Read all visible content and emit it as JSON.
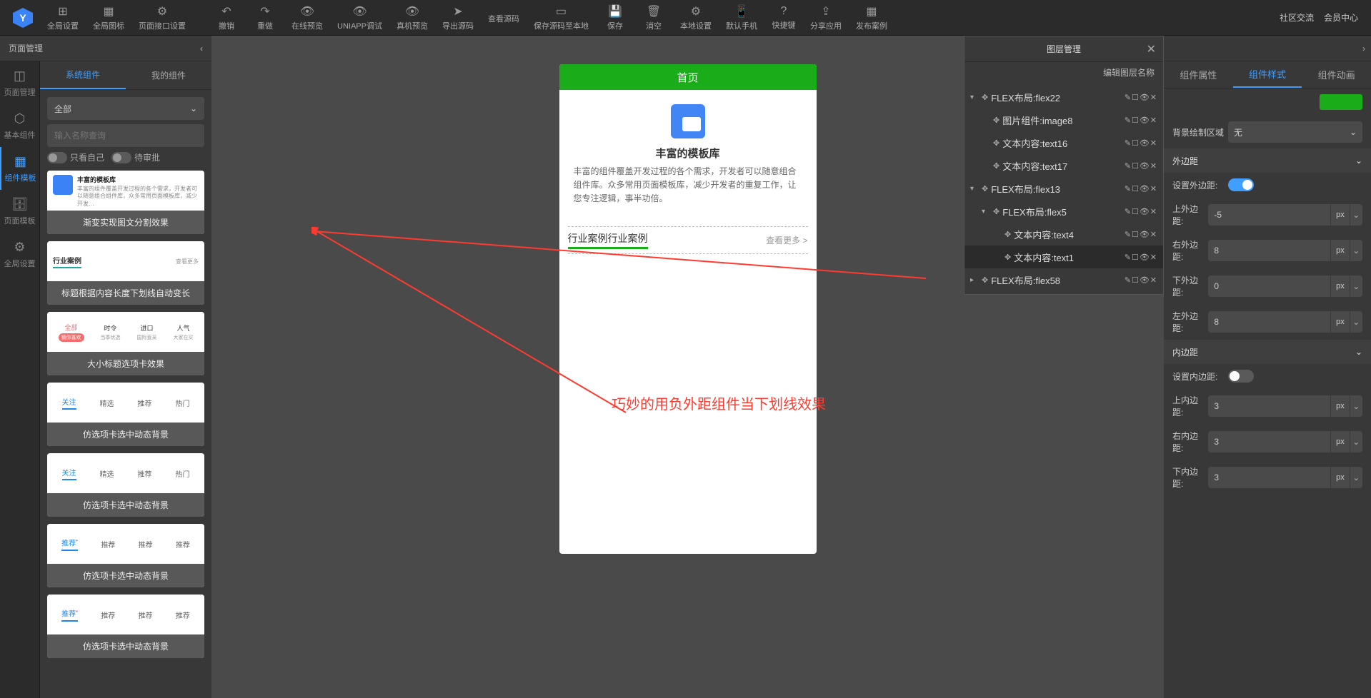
{
  "toolbar": {
    "items": [
      {
        "label": "全局设置",
        "icon": "⊞"
      },
      {
        "label": "全局图标",
        "icon": "▦"
      },
      {
        "label": "页面接口设置",
        "icon": "⚙"
      },
      {
        "label": "撤销",
        "icon": "↶"
      },
      {
        "label": "重做",
        "icon": "↷"
      },
      {
        "label": "在线预览",
        "icon": "👁"
      },
      {
        "label": "UNIAPP调试",
        "icon": "👁"
      },
      {
        "label": "真机预览",
        "icon": "👁"
      },
      {
        "label": "导出源码",
        "icon": "➤"
      },
      {
        "label": "查看源码",
        "icon": "</>"
      },
      {
        "label": "保存源码至本地",
        "icon": "▭"
      },
      {
        "label": "保存",
        "icon": "💾"
      },
      {
        "label": "消空",
        "icon": "🗑"
      },
      {
        "label": "本地设置",
        "icon": "⚙"
      },
      {
        "label": "默认手机",
        "icon": "📱"
      },
      {
        "label": "快捷键",
        "icon": "?"
      },
      {
        "label": "分享应用",
        "icon": "⇪"
      },
      {
        "label": "发布案例",
        "icon": "▦"
      }
    ],
    "right_links": [
      "社区交流",
      "会员中心"
    ]
  },
  "page_mgmt_title": "页面管理",
  "left_sidebar": [
    {
      "label": "页面管理",
      "icon": "◫"
    },
    {
      "label": "基本组件",
      "icon": "⬡"
    },
    {
      "label": "组件模板",
      "icon": "▦",
      "active": true
    },
    {
      "label": "页面模板",
      "icon": "🗄"
    },
    {
      "label": "全局设置",
      "icon": "⚙"
    }
  ],
  "component_tabs": [
    "系统组件",
    "我的组件"
  ],
  "component_tab_active": 0,
  "category_select": "全部",
  "search_placeholder": "输入名称查询",
  "toggle_labels": [
    "只看自己",
    "待审批"
  ],
  "templates": [
    {
      "type": "t1",
      "title": "丰富的模板库",
      "desc": "丰富的组件覆盖开发过程的各个需求，开发者可以随意组合组件库，众多常用页面模板库，减少开发…",
      "label": "渐变实现图文分割效果"
    },
    {
      "type": "title",
      "tleft": "行业案例",
      "tright": "查看更多",
      "label": "标题根据内容长度下划线自动变长"
    },
    {
      "type": "tabs1",
      "label": "大小标题选项卡效果",
      "cols": [
        {
          "main": "全部",
          "sub": "猜你喜欢",
          "active": true
        },
        {
          "main": "时令",
          "sub": "当季优选"
        },
        {
          "main": "进口",
          "sub": "国际直采"
        },
        {
          "main": "人气",
          "sub": "大家在买"
        }
      ]
    },
    {
      "type": "tabs2",
      "label": "仿选项卡选中动态背景",
      "cols": [
        "关注",
        "精选",
        "推荐",
        "热门"
      ],
      "active": 0
    },
    {
      "type": "tabs2",
      "label": "仿选项卡选中动态背景",
      "cols": [
        "关注",
        "精选",
        "推荐",
        "热门"
      ],
      "active": 0
    },
    {
      "type": "tabs2",
      "label": "仿选项卡选中动态背景",
      "cols": [
        "推荐",
        "推荐",
        "推荐",
        "推荐"
      ],
      "active": 0
    },
    {
      "type": "tabs2",
      "label": "仿选项卡选中动态背景",
      "cols": [
        "推荐",
        "推荐",
        "推荐",
        "推荐"
      ],
      "active": 0
    }
  ],
  "phone": {
    "header": "首页",
    "card_title": "丰富的模板库",
    "card_desc": "丰富的组件覆盖开发过程的各个需求，开发者可以随意组合组件库。众多常用页面模板库，减少开发者的重复工作，让您专注逻辑，事半功倍。",
    "section_title": "行业案例行业案例",
    "section_more": "查看更多 >"
  },
  "annotation": "巧妙的用负外距组件当下划线效果",
  "layer_panel": {
    "title": "图层管理",
    "edit_name": "编辑图层名称",
    "nodes": [
      {
        "depth": 0,
        "caret": "▾",
        "name": "FLEX布局:flex22"
      },
      {
        "depth": 1,
        "caret": "",
        "name": "图片组件:image8"
      },
      {
        "depth": 1,
        "caret": "",
        "name": "文本内容:text16"
      },
      {
        "depth": 1,
        "caret": "",
        "name": "文本内容:text17"
      },
      {
        "depth": 0,
        "caret": "▾",
        "name": "FLEX布局:flex13"
      },
      {
        "depth": 1,
        "caret": "▾",
        "name": "FLEX布局:flex5"
      },
      {
        "depth": 2,
        "caret": "",
        "name": "文本内容:text4"
      },
      {
        "depth": 2,
        "caret": "",
        "name": "文本内容:text1",
        "active": true
      },
      {
        "depth": 0,
        "caret": "▸",
        "name": "FLEX布局:flex58"
      }
    ],
    "action_icons": "✎☐👁✕"
  },
  "right_panel": {
    "tabs": [
      "组件属性",
      "组件样式",
      "组件动画"
    ],
    "tab_active": 1,
    "bg_area_label": "背景绘制区域",
    "bg_area_value": "无",
    "sections": {
      "outer": {
        "title": "外边距",
        "set_label": "设置外边距:",
        "set_on": true,
        "fields": [
          {
            "label": "上外边距:",
            "value": "-5",
            "unit": "px"
          },
          {
            "label": "右外边距:",
            "value": "8",
            "unit": "px"
          },
          {
            "label": "下外边距:",
            "value": "0",
            "unit": "px"
          },
          {
            "label": "左外边距:",
            "value": "8",
            "unit": "px"
          }
        ]
      },
      "inner": {
        "title": "内边距",
        "set_label": "设置内边距:",
        "set_on": false,
        "fields": [
          {
            "label": "上内边距:",
            "value": "3",
            "unit": "px"
          },
          {
            "label": "右内边距:",
            "value": "3",
            "unit": "px"
          },
          {
            "label": "下内边距:",
            "value": "3",
            "unit": "px"
          }
        ]
      }
    }
  }
}
